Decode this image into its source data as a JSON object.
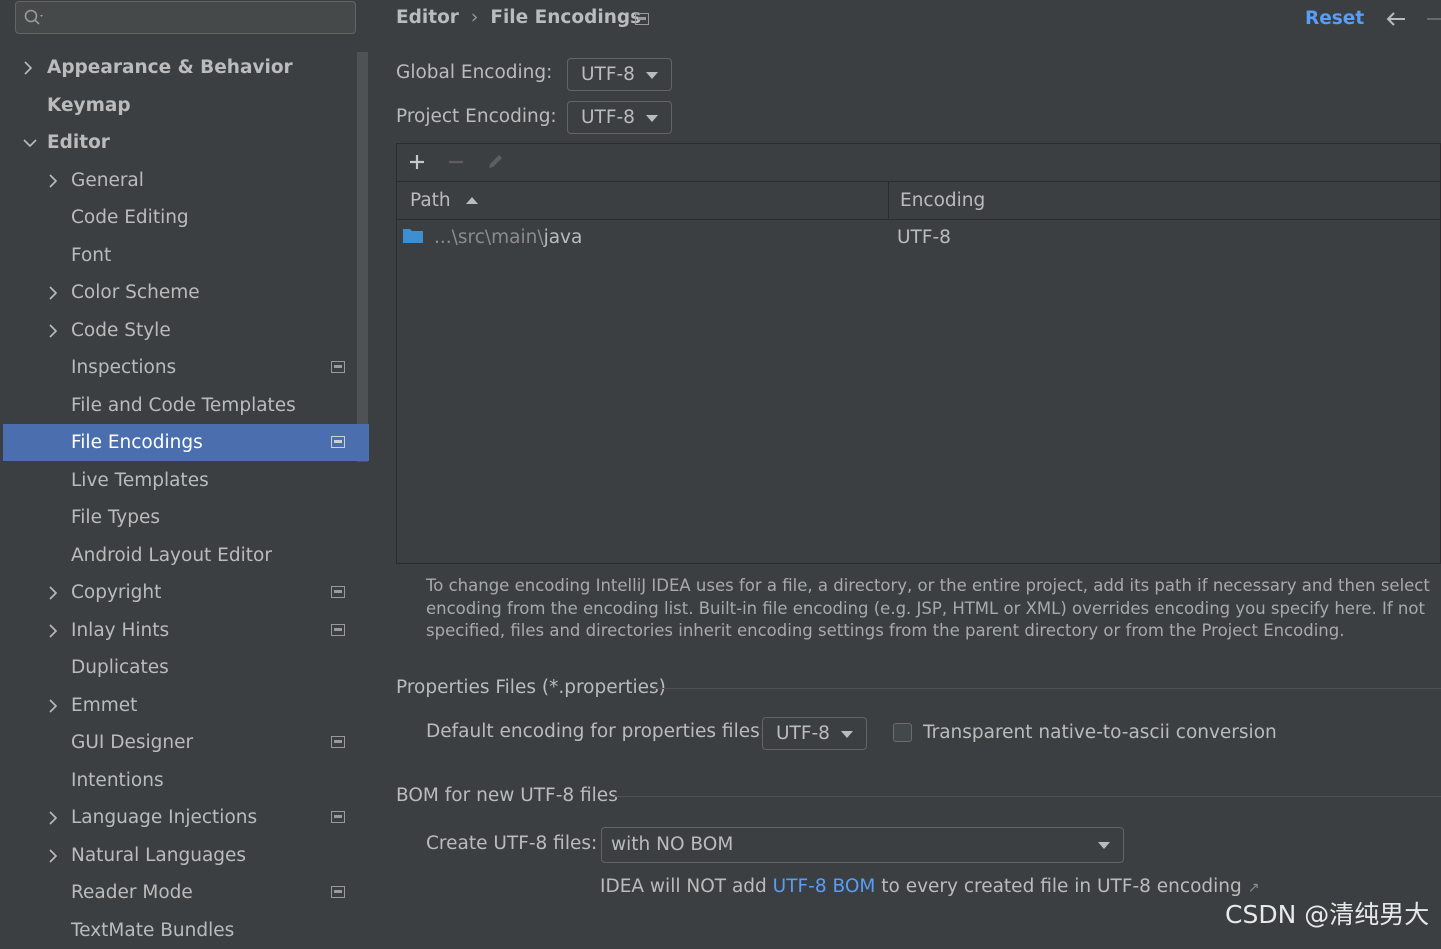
{
  "search": {
    "placeholder": ""
  },
  "sidebar": {
    "items": [
      {
        "label": "Appearance & Behavior"
      },
      {
        "label": "Keymap"
      },
      {
        "label": "Editor"
      },
      {
        "label": "General"
      },
      {
        "label": "Code Editing"
      },
      {
        "label": "Font"
      },
      {
        "label": "Color Scheme"
      },
      {
        "label": "Code Style"
      },
      {
        "label": "Inspections"
      },
      {
        "label": "File and Code Templates"
      },
      {
        "label": "File Encodings"
      },
      {
        "label": "Live Templates"
      },
      {
        "label": "File Types"
      },
      {
        "label": "Android Layout Editor"
      },
      {
        "label": "Copyright"
      },
      {
        "label": "Inlay Hints"
      },
      {
        "label": "Duplicates"
      },
      {
        "label": "Emmet"
      },
      {
        "label": "GUI Designer"
      },
      {
        "label": "Intentions"
      },
      {
        "label": "Language Injections"
      },
      {
        "label": "Natural Languages"
      },
      {
        "label": "Reader Mode"
      },
      {
        "label": "TextMate Bundles"
      }
    ]
  },
  "header": {
    "breadcrumb_parent": "Editor",
    "breadcrumb_separator": "›",
    "breadcrumb_current": "File Encodings",
    "reset_label": "Reset"
  },
  "encodings": {
    "global_label": "Global Encoding:",
    "global_value": "UTF-8",
    "project_label": "Project Encoding:",
    "project_value": "UTF-8"
  },
  "table": {
    "columns": [
      "Path",
      "Encoding"
    ],
    "rows": [
      {
        "path_prefix": "...\\src\\main\\",
        "path_last": "java",
        "encoding": "UTF-8"
      }
    ]
  },
  "help_text": "To change encoding IntelliJ IDEA uses for a file, a directory, or the entire project, add its path if necessary and then select encoding from the encoding list. Built-in file encoding (e.g. JSP, HTML or XML) overrides encoding you specify here. If not specified, files and directories inherit encoding settings from the parent directory or from the Project Encoding.",
  "properties": {
    "section_title": "Properties Files (*.properties)",
    "default_label": "Default encoding for properties files:",
    "default_value": "UTF-8",
    "transparent_label": "Transparent native-to-ascii conversion"
  },
  "bom": {
    "section_title": "BOM for new UTF-8 files",
    "create_label": "Create UTF-8 files:",
    "create_value": "with NO BOM",
    "note_before": "IDEA will NOT add ",
    "note_link": "UTF-8 BOM",
    "note_after": " to every created file in UTF-8 encoding",
    "note_icon": "↗"
  },
  "watermark": "CSDN @清纯男大",
  "colors": {
    "selection": "#4b6eaf",
    "link": "#589df6",
    "background": "#3c3f41"
  }
}
